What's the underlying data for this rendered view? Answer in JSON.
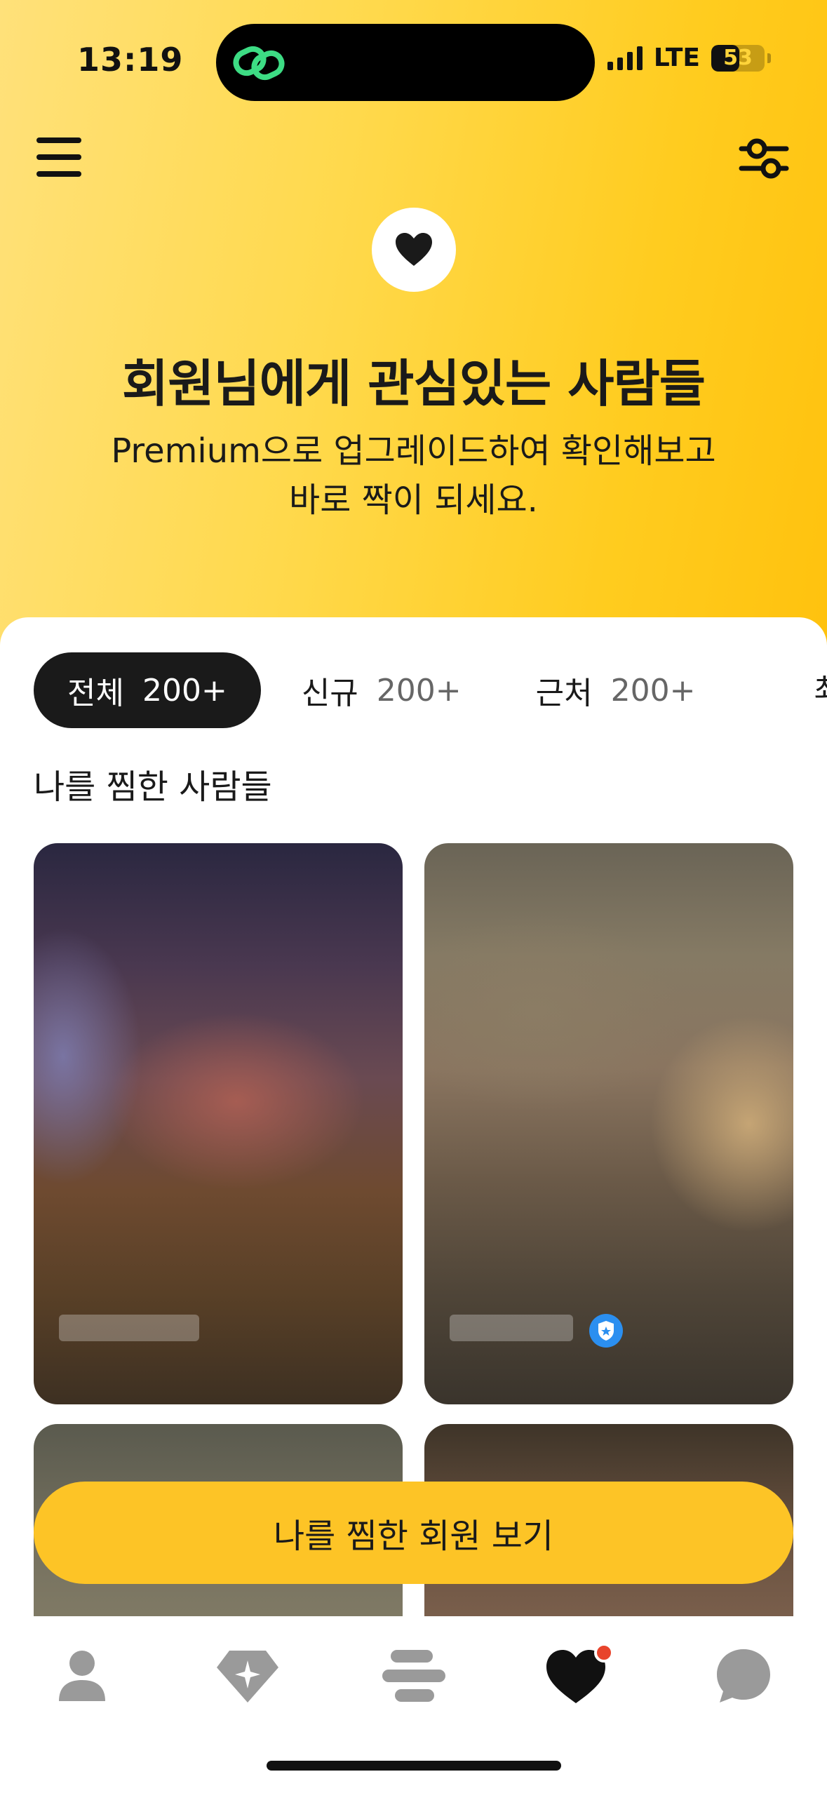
{
  "status_bar": {
    "time": "13:19",
    "network": "LTE",
    "battery_level": 53,
    "battery_text": "53"
  },
  "header": {
    "menu_icon": "hamburger-menu-icon",
    "filter_icon": "filter-sliders-icon",
    "badge_icon": "heart-icon"
  },
  "hero": {
    "title": "회원님에게 관심있는 사람들",
    "subtitle_line1": "Premium으로 업그레이드하여 확인해보고",
    "subtitle_line2": "바로 짝이 되세요."
  },
  "tabs": [
    {
      "label": "전체",
      "count": "200+",
      "active": true
    },
    {
      "label": "신규",
      "count": "200+",
      "active": false
    },
    {
      "label": "근처",
      "count": "200+",
      "active": false
    }
  ],
  "section": {
    "title": "나를 찜한 사람들"
  },
  "cards": [
    {
      "verified": false
    },
    {
      "verified": true
    },
    {
      "verified": false
    },
    {
      "verified": false
    }
  ],
  "cta": {
    "label": "나를 찜한 회원 보기"
  },
  "bottom_nav": [
    {
      "icon": "profile-icon",
      "active": false
    },
    {
      "icon": "diamond-sparkle-icon",
      "active": false
    },
    {
      "icon": "stack-cards-icon",
      "active": false
    },
    {
      "icon": "heart-icon",
      "active": true,
      "notification_dot": true
    },
    {
      "icon": "chat-bubble-icon",
      "active": false
    }
  ],
  "colors": {
    "brand_yellow": "#fdc426",
    "hero_gradient_start": "#ffe17a",
    "hero_gradient_end": "#ffc20e",
    "dark": "#1a1a1a",
    "nav_inactive": "#9a9a9a",
    "notification_red": "#e8442c",
    "verified_blue": "#2b8ff0"
  }
}
